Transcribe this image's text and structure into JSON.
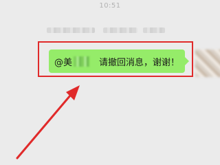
{
  "chat": {
    "timestamp": "10:51",
    "message": {
      "mention": "@美",
      "text": "请撤回消息，谢谢！"
    }
  },
  "colors": {
    "background": "#ebebeb",
    "bubble": "#95ec69",
    "highlight": "#e02a2a"
  },
  "annotation": {
    "type": "red-arrow-pointing-to-message"
  }
}
